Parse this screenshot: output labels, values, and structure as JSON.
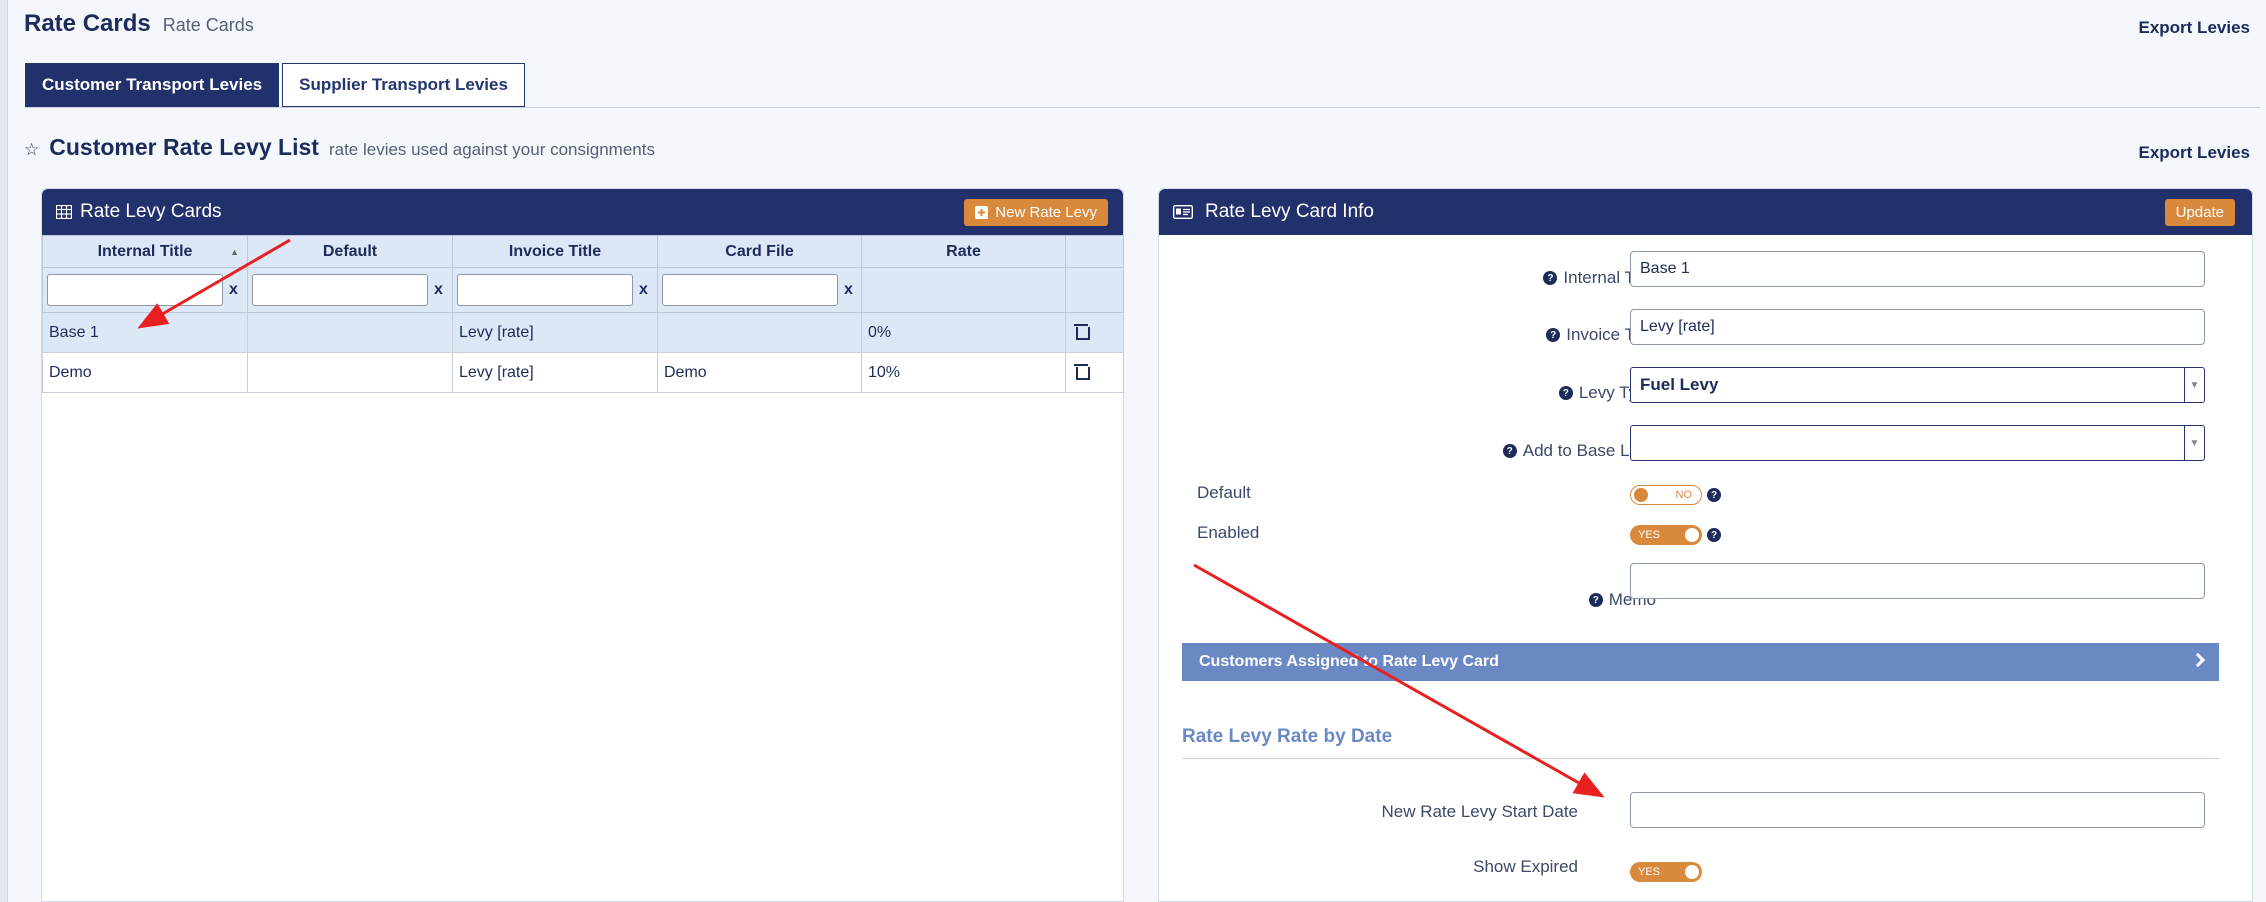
{
  "page": {
    "title": "Rate Cards",
    "subtitle": "Rate Cards",
    "export_top": "Export Levies"
  },
  "tabs": [
    {
      "label": "Customer Transport Levies",
      "active": true
    },
    {
      "label": "Supplier Transport Levies",
      "active": false
    }
  ],
  "list": {
    "title": "Customer Rate Levy List",
    "subtitle": "rate levies used against your consignments",
    "export_label": "Export Levies"
  },
  "left_panel": {
    "title": "Rate Levy Cards",
    "new_button": "New Rate Levy",
    "columns": [
      "Internal Title",
      "Default",
      "Invoice Title",
      "Card File",
      "Rate"
    ],
    "clear_label": "x",
    "rows": [
      {
        "internal_title": "Base 1",
        "default": "",
        "invoice_title": "Levy [rate]",
        "card_file": "",
        "rate": "0%",
        "selected": true
      },
      {
        "internal_title": "Demo",
        "default": "",
        "invoice_title": "Levy [rate]",
        "card_file": "Demo",
        "rate": "10%",
        "selected": false
      }
    ]
  },
  "right_panel": {
    "title": "Rate Levy Card Info",
    "update_button": "Update",
    "fields": {
      "internal_title": {
        "label": "Internal Title",
        "value": "Base 1"
      },
      "invoice_title": {
        "label": "Invoice Title",
        "value": "Levy [rate]"
      },
      "levy_type": {
        "label": "Levy Type",
        "value": "Fuel Levy"
      },
      "add_to_base": {
        "label": "Add to Base Levy",
        "value": ""
      },
      "default": {
        "label": "Default",
        "toggle": "NO"
      },
      "enabled": {
        "label": "Enabled",
        "toggle": "YES"
      },
      "memo": {
        "label": "Memo",
        "value": ""
      }
    },
    "accordion": "Customers Assigned to Rate Levy Card",
    "section_title": "Rate Levy Rate by Date",
    "start_date": {
      "label": "New Rate Levy Start Date",
      "value": ""
    },
    "show_expired": {
      "label": "Show Expired",
      "toggle": "YES"
    }
  },
  "colors": {
    "navy": "#22306c",
    "orange": "#d9893c",
    "accordion": "#6a89c4",
    "annotation": "#e8201f"
  }
}
